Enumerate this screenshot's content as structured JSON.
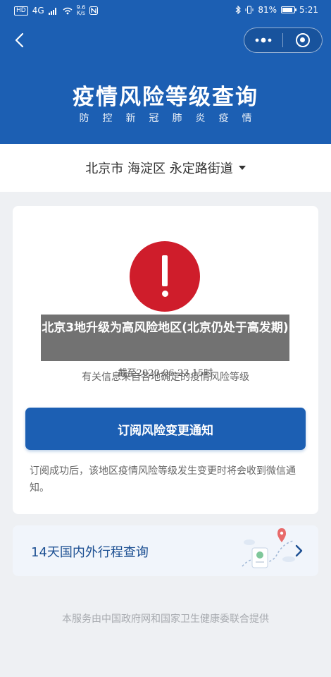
{
  "status_bar": {
    "network": "4G",
    "speed_value": "9.6",
    "speed_unit": "K/s",
    "battery": "81%",
    "time": "5:21"
  },
  "header": {
    "title": "疫情风险等级查询",
    "subtitle": "防控新冠肺炎疫情",
    "background_color": "#1c5fb3"
  },
  "location": {
    "text": "北京市 海淀区 永定路街道"
  },
  "risk_card": {
    "icon": "exclamation-icon",
    "level_text": "",
    "deadline": "截至2020-06-23 15时",
    "source_note": "有关信息来自各地确定的疫情风险等级",
    "accent_color": "#cf1d2b",
    "subscribe_button": "订阅风险变更通知",
    "subscribe_note": "订阅成功后，该地区疫情风险等级发生变更时将会收到微信通知。"
  },
  "itinerary": {
    "label": "14天国内外行程查询",
    "illustration": "map-route-icon"
  },
  "footer": {
    "text": "本服务由中国政府网和国家卫生健康委联合提供"
  },
  "overlay": {
    "headline": "北京3地升级为高风险地区(北京仍处于高发期)"
  }
}
